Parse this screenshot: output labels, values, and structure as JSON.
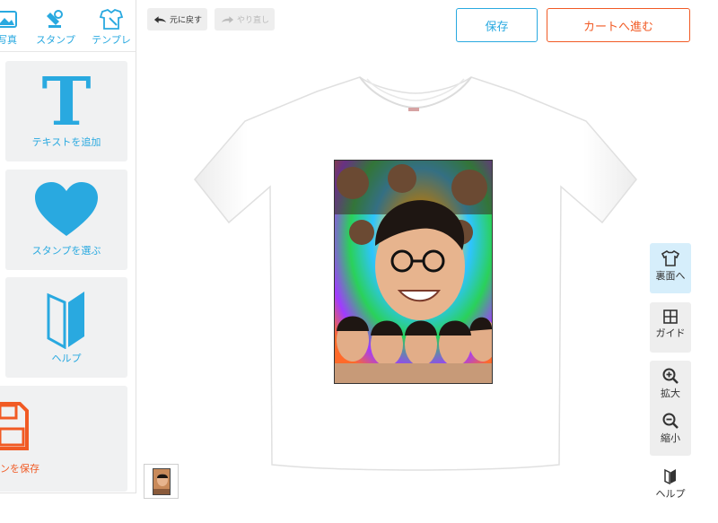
{
  "toolbar": {
    "undo_label": "元に戻す",
    "redo_label": "やり直し",
    "save_label": "保存",
    "cart_label": "カートへ進む"
  },
  "left_panel": {
    "tabs": [
      {
        "label": "写真",
        "icon": "photo-icon"
      },
      {
        "label": "スタンプ",
        "icon": "stamp-icon"
      },
      {
        "label": "テンプレ",
        "icon": "template-icon"
      }
    ],
    "cards": [
      {
        "label": "テキストを追加",
        "icon": "text-T-icon",
        "glyph": "T"
      },
      {
        "label": "スタンプを選ぶ",
        "icon": "heart-icon"
      },
      {
        "label": "ヘルプ",
        "icon": "beginner-mark-icon"
      },
      {
        "label": "ンを保存",
        "icon": "floppy-save-icon"
      }
    ]
  },
  "right_sidebar": {
    "back_label": "裏面へ",
    "guide_label": "ガイド",
    "zoom_in_label": "拡大",
    "zoom_out_label": "縮小",
    "help_label": "ヘルプ"
  },
  "colors": {
    "accent_blue": "#29a9e0",
    "accent_orange": "#f15a24",
    "panel_gray": "#f0f1f2",
    "active_blue_bg": "#d6eefb"
  }
}
